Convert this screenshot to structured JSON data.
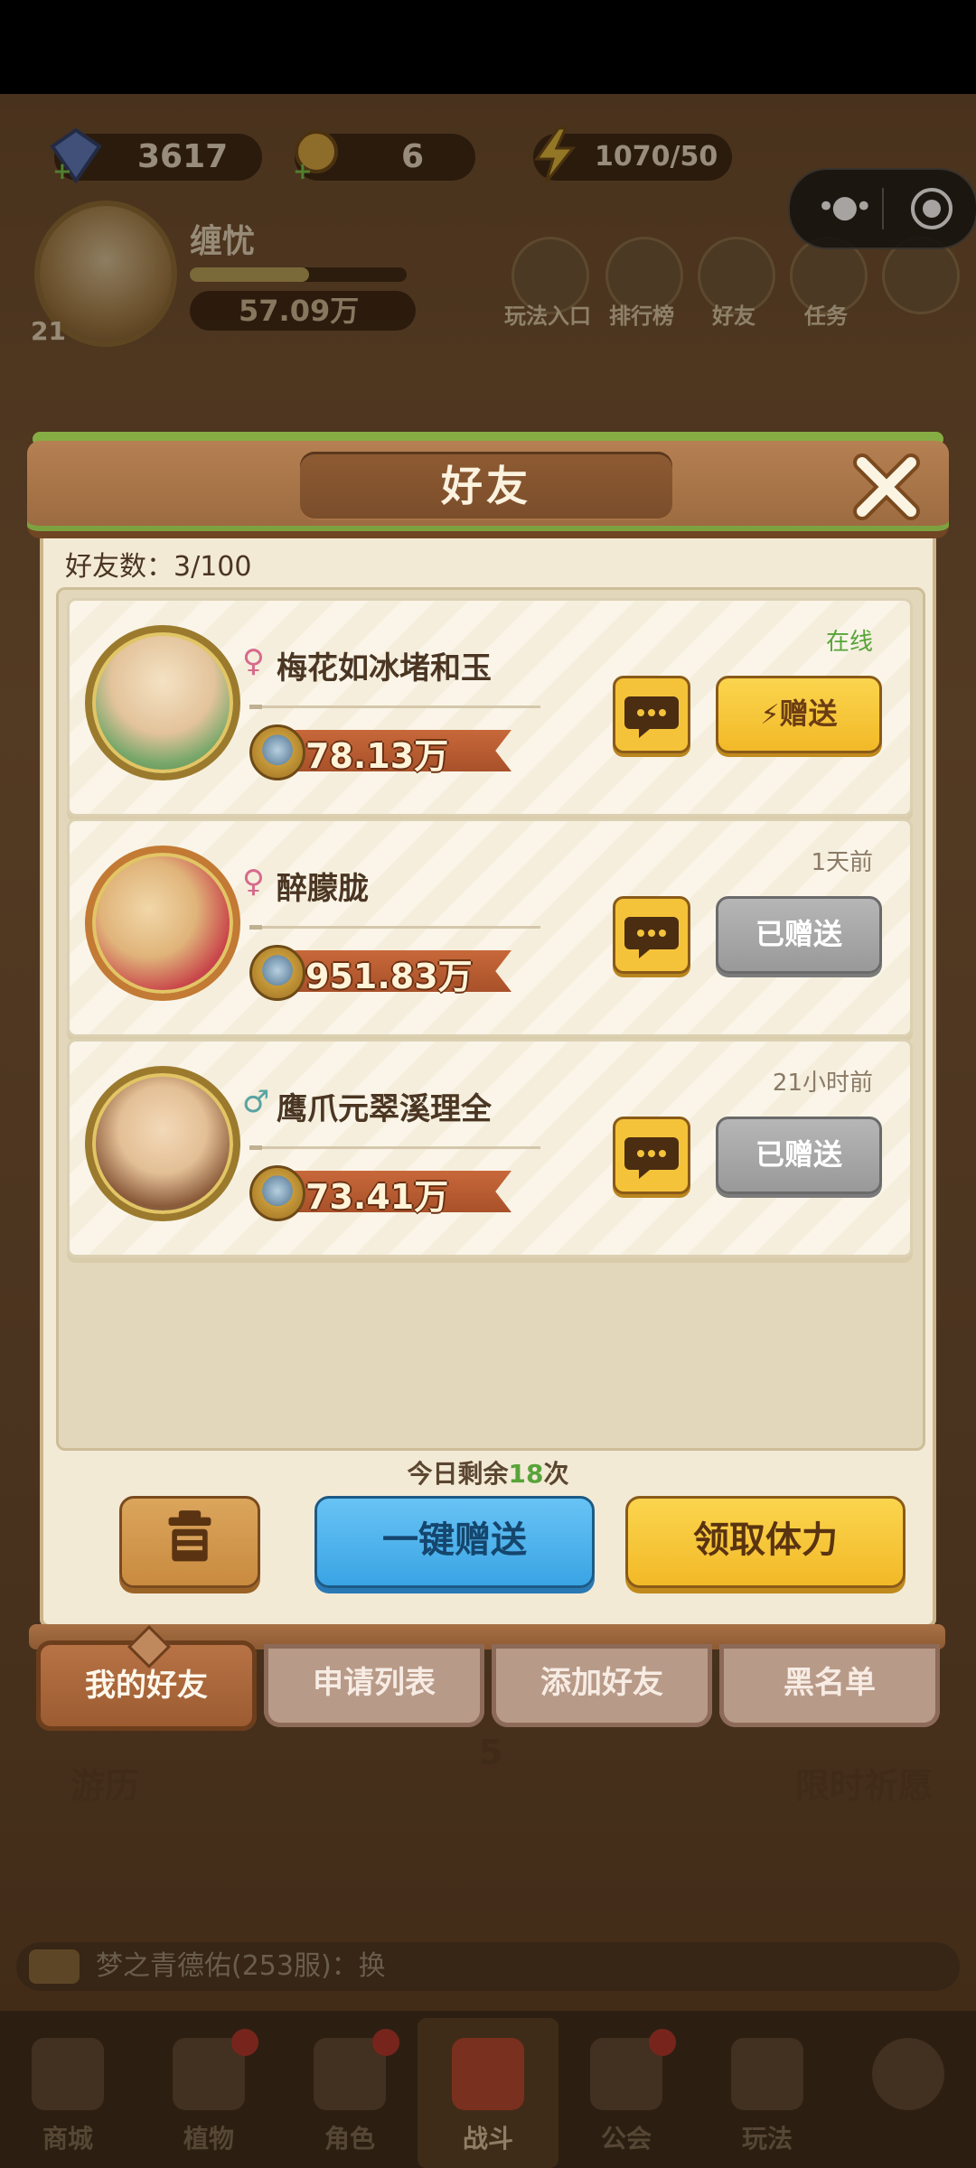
{
  "hud": {
    "gems": "3617",
    "keys": "6",
    "stamina": "1070/50",
    "player": {
      "name": "缠忧",
      "level": "21",
      "power": "57.09万"
    },
    "nav": [
      "玩法入口",
      "排行榜",
      "好友",
      "任务"
    ]
  },
  "bottom_labels": {
    "left": "游历",
    "right": "限时祈愿",
    "center_count": "5"
  },
  "chat": {
    "text": "梦之青德佑(253服)：换"
  },
  "bottom_nav": [
    "商城",
    "植物",
    "角色",
    "战斗",
    "公会",
    "玩法",
    ""
  ],
  "modal": {
    "title": "好友",
    "friend_count": "好友数：3/100",
    "friends": [
      {
        "name": "梅花如冰堵和玉",
        "gender": "female",
        "gender_symbol": "♀",
        "power": "78.13万",
        "status": "在线",
        "status_color": "#58a43a",
        "gift_label": "赠送",
        "gift_state": "active"
      },
      {
        "name": "醉朦胧",
        "gender": "female",
        "gender_symbol": "♀",
        "power": "951.83万",
        "status": "1天前",
        "status_color": "#8a7a66",
        "gift_label": "已赠送",
        "gift_state": "done"
      },
      {
        "name": "鹰爪元翠溪理全",
        "gender": "male",
        "gender_symbol": "♂",
        "power": "73.41万",
        "status": "21小时前",
        "status_color": "#8a7a66",
        "gift_label": "已赠送",
        "gift_state": "done"
      }
    ],
    "remaining_prefix": "今日剩余",
    "remaining_count": "18",
    "remaining_suffix": "次",
    "buttons": {
      "one_click": "一键赠送",
      "claim": "领取体力"
    },
    "tabs": [
      "我的好友",
      "申请列表",
      "添加好友",
      "黑名单"
    ],
    "active_tab": 0
  },
  "colors": {
    "female": "#d66a8c",
    "male": "#5aa3a3",
    "accent_yellow": "#f2b928",
    "accent_blue": "#3aa4e4"
  }
}
